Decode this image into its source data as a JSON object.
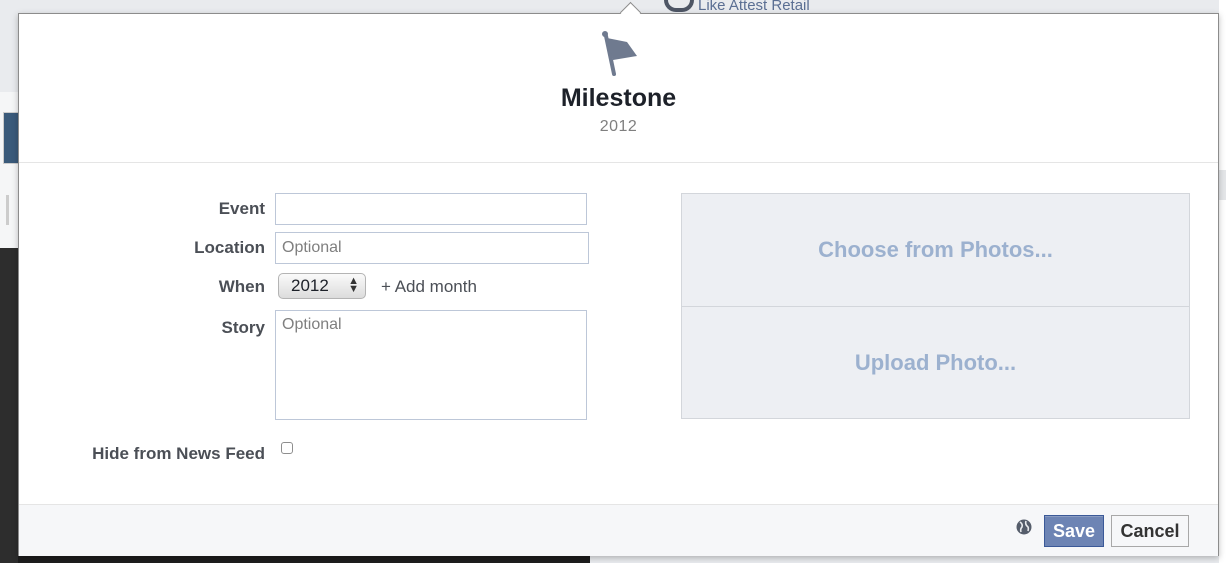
{
  "background": {
    "top_text": "Like Attest Retail"
  },
  "dialog": {
    "icon": "flag-icon",
    "title": "Milestone",
    "year": "2012",
    "form": {
      "event_label": "Event",
      "event_value": "",
      "location_label": "Location",
      "location_placeholder": "Optional",
      "when_label": "When",
      "when_selected": "2012",
      "add_month": "+ Add month",
      "story_label": "Story",
      "story_placeholder": "Optional",
      "hide_label": "Hide from News Feed",
      "hide_checked": false
    },
    "photo": {
      "choose": "Choose from Photos...",
      "upload": "Upload Photo..."
    },
    "footer": {
      "privacy_icon": "globe-icon",
      "save": "Save",
      "cancel": "Cancel"
    }
  },
  "colors": {
    "accent": "#6d84b4",
    "photo_text": "#9cb1cf"
  }
}
